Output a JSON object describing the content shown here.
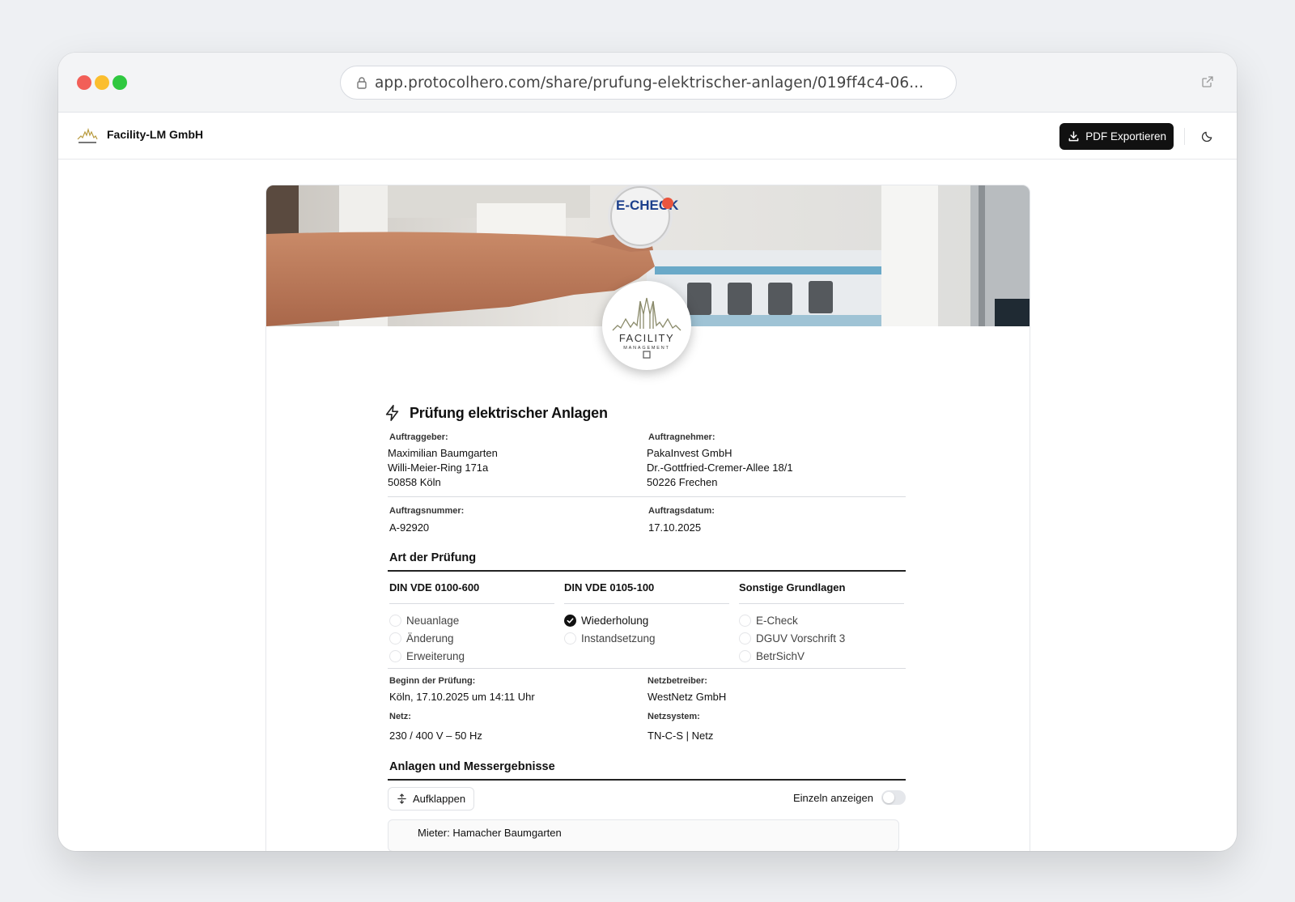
{
  "browser": {
    "url": "app.protocolhero.com/share/prufung-elektrischer-anlagen/019ff4c4-06..."
  },
  "appbar": {
    "brand_name": "Facility-LM GmbH",
    "pdf_button": "PDF Exportieren",
    "icons": [
      "download-icon",
      "moon-icon"
    ]
  },
  "document": {
    "title": "Prüfung elektrischer Anlagen",
    "client": {
      "label": "Auftraggeber:",
      "name": "Maximilian Baumgarten",
      "street": "Willi-Meier-Ring 171a",
      "city": "50858 Köln"
    },
    "contractor": {
      "label": "Auftragnehmer:",
      "name": "PakaInvest GmbH",
      "street": "Dr.-Gottfried-Cremer-Allee 18/1",
      "city": "50226 Frechen"
    },
    "order_number": {
      "label": "Auftragsnummer:",
      "value": "A-92920"
    },
    "order_date": {
      "label": "Auftragsdatum:",
      "value": "17.10.2025"
    },
    "test_type": {
      "title": "Art der Prüfung",
      "columns": [
        {
          "header": "DIN VDE 0100-600",
          "options": [
            {
              "label": "Neuanlage",
              "checked": false
            },
            {
              "label": "Änderung",
              "checked": false
            },
            {
              "label": "Erweiterung",
              "checked": false
            }
          ]
        },
        {
          "header": "DIN VDE 0105-100",
          "options": [
            {
              "label": "Wiederholung",
              "checked": true
            },
            {
              "label": "Instandsetzung",
              "checked": false
            }
          ]
        },
        {
          "header": "Sonstige Grundlagen",
          "options": [
            {
              "label": "E-Check",
              "checked": false
            },
            {
              "label": "DGUV Vorschrift 3",
              "checked": false
            },
            {
              "label": "BetrSichV",
              "checked": false
            }
          ]
        }
      ]
    },
    "test_start": {
      "label": "Beginn der Prüfung:",
      "value": "Köln, 17.10.2025 um 14:11 Uhr"
    },
    "grid_operator": {
      "label": "Netzbetreiber:",
      "value": "WestNetz GmbH"
    },
    "network": {
      "label": "Netz:",
      "value": "230 / 400 V – 50 Hz"
    },
    "network_system": {
      "label": "Netzsystem:",
      "value": "TN-C-S | Netz"
    },
    "installations": {
      "title": "Anlagen und Messergebnisse",
      "expand_button": "Aufklappen",
      "toggle_label": "Einzeln anzeigen",
      "toggle_on": false,
      "first_item": "Mieter: Hamacher Baumgarten"
    }
  },
  "banner": {
    "sticker_text": "E-CHECK"
  },
  "logo": {
    "text_main": "FACILITY",
    "text_sub": "MANAGEMENT"
  }
}
